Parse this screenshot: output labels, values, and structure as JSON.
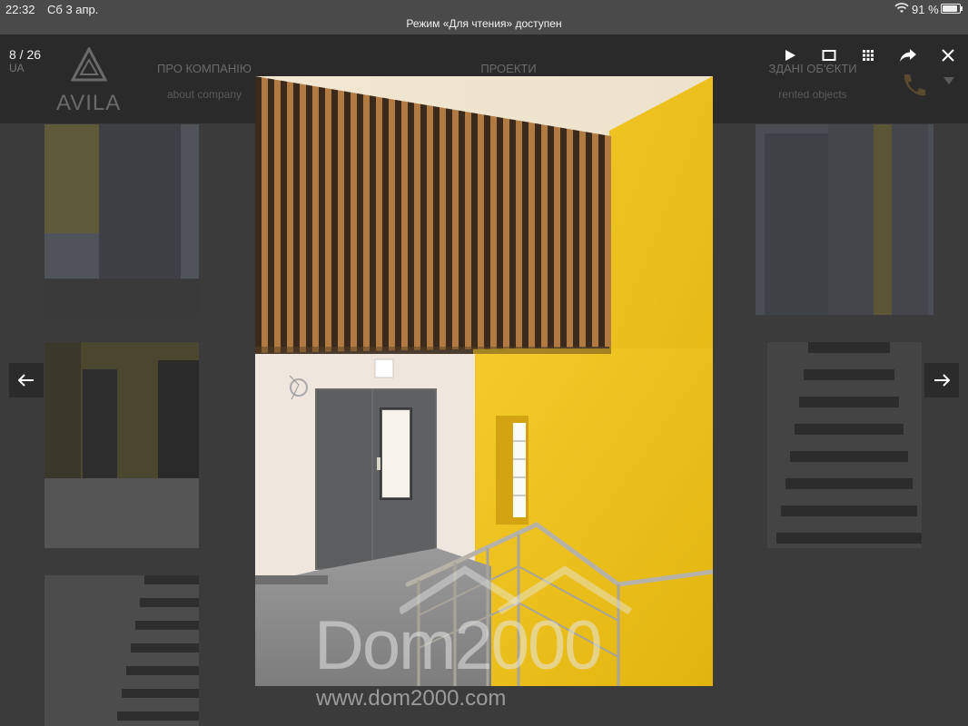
{
  "status_bar": {
    "time": "22:32",
    "date": "Сб 3 апр.",
    "reader_notice": "Режим «Для чтения» доступен",
    "battery": "91 %",
    "battery_level": 0.91
  },
  "site": {
    "logo": "AVILA",
    "lang": "UA",
    "nav": [
      {
        "label": "ПРО КОМПАНІЮ",
        "sub": "about company"
      },
      {
        "label": "ПРОЕКТИ",
        "sub": ""
      },
      {
        "label": "ЗДАНІ ОБ'ЄКТИ",
        "sub": "rented objects"
      }
    ]
  },
  "viewer": {
    "counter": "8 / 26",
    "tools": [
      "play-icon",
      "fullscreen-icon",
      "grid-icon",
      "share-icon",
      "close-icon"
    ]
  },
  "watermark": {
    "logo_text": "Dom2000",
    "url": "www.dom2000.com"
  },
  "colors": {
    "overlay": "#3b3b3b",
    "wall_yellow": "#f2c21a",
    "slats_dark": "#3a2a1a"
  }
}
